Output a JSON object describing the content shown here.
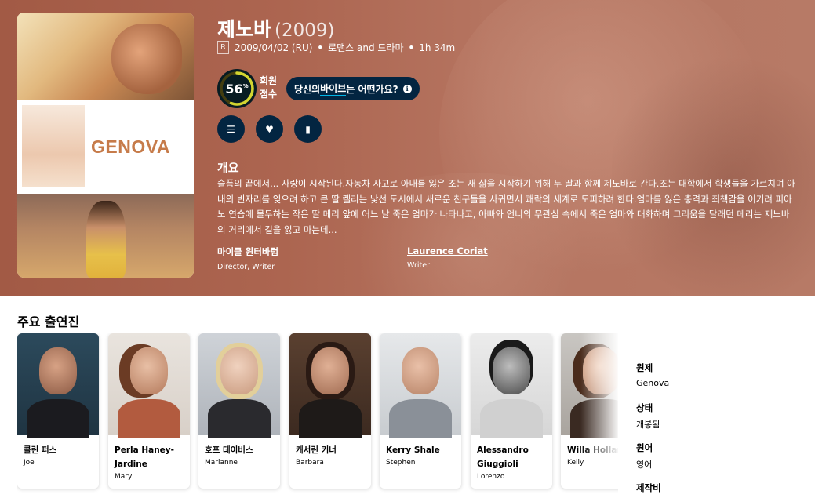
{
  "movie": {
    "title": "제노바",
    "year": "(2009)",
    "certification": "R",
    "release": "2009/04/02 (RU)",
    "genres": "로맨스 and 드라마",
    "runtime": "1h 34m",
    "poster_title": "GENOVA"
  },
  "score": {
    "value": "56",
    "percent_sign": "%",
    "fraction": 0.56,
    "label_line1": "회원",
    "label_line2": "점수",
    "ring_color": "#d2d531"
  },
  "vibe": {
    "prefix": "당신의 ",
    "highlight": "바이브",
    "suffix": "는 어떤가요?",
    "info_glyph": "i"
  },
  "actions": [
    {
      "icon": "list-icon",
      "glyph": "☰"
    },
    {
      "icon": "heart-icon",
      "glyph": "♥"
    },
    {
      "icon": "bookmark-icon",
      "glyph": "▮"
    }
  ],
  "overview": {
    "heading": "개요",
    "text": "슬픔의 끝에서... 사랑이 시작된다.자동차 사고로 아내를 잃은 조는 새 삶을 시작하기 위해 두 딸과 함께 제노바로 간다.조는 대학에서 학생들을 가르치며 아내의 빈자리를 잊으려 하고 큰 딸 켈리는 낯선 도시에서 새로운 친구들을 사귀면서 쾌락의 세계로 도피하려 한다.엄마를 잃은 충격과 죄책감을 이기려 피아노 연습에 몰두하는 작은 딸 메리 앞에 어느 날 죽은 엄마가 나타나고, 아빠와 언니의 무관심 속에서 죽은 엄마와 대화하며 그리움을 달래던 메리는 제노바의 거리에서 길을 잃고 마는데..."
  },
  "crew": [
    {
      "name": "마이클 윈터바텀",
      "job": "Director, Writer"
    },
    {
      "name": "Laurence Coriat",
      "job": "Writer"
    }
  ],
  "cast_heading": "주요 출연진",
  "cast": [
    {
      "name": "콜린 퍼스",
      "role": "Joe"
    },
    {
      "name": "Perla Haney-Jardine",
      "role": "Mary"
    },
    {
      "name": "호프 데이비스",
      "role": "Marianne"
    },
    {
      "name": "캐서린 키너",
      "role": "Barbara"
    },
    {
      "name": "Kerry Shale",
      "role": "Stephen"
    },
    {
      "name": "Alessandro Giuggioli",
      "role": "Lorenzo"
    },
    {
      "name": "Willa Holland",
      "role": "Kelly"
    }
  ],
  "facts": [
    {
      "label": "원제",
      "value": "Genova"
    },
    {
      "label": "상태",
      "value": "개봉됨"
    },
    {
      "label": "원어",
      "value": "영어"
    },
    {
      "label": "제작비",
      "value": ""
    }
  ],
  "colors": {
    "hero_bg": "#ab6450",
    "navy": "#032541",
    "accent_blue": "#01b4e4"
  }
}
